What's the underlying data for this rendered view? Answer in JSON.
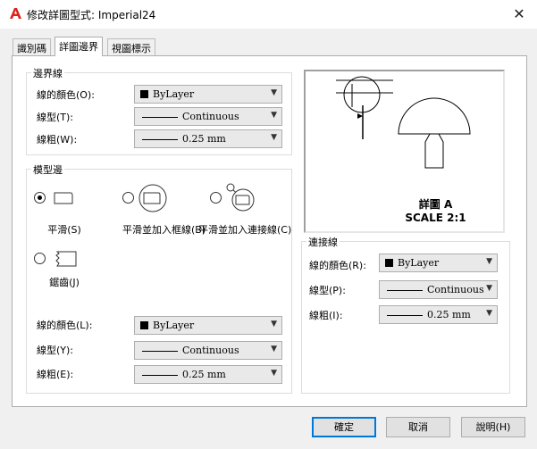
{
  "window": {
    "title": "修改詳圖型式: Imperial24",
    "close_glyph": "✕"
  },
  "tabs": [
    {
      "label": "識別碼",
      "active": false
    },
    {
      "label": "詳圖邊界",
      "active": true
    },
    {
      "label": "視圖標示",
      "active": false
    }
  ],
  "boundary": {
    "title": "邊界線",
    "color": {
      "label": "線的顏色(O):",
      "value": "ByLayer"
    },
    "linetype": {
      "label": "線型(T):",
      "value": "Continuous"
    },
    "lineweight": {
      "label": "線粗(W):",
      "value": "0.25 mm"
    }
  },
  "model_edge": {
    "title": "模型邊",
    "options": [
      {
        "label": "平滑(S)",
        "selected": true
      },
      {
        "label": "平滑並加入框線(B)",
        "selected": false
      },
      {
        "label": "平滑並加入連接線(C)",
        "selected": false
      },
      {
        "label": "鋸齒(J)",
        "selected": false
      }
    ],
    "color": {
      "label": "線的顏色(L):",
      "value": "ByLayer"
    },
    "linetype": {
      "label": "線型(Y):",
      "value": "Continuous"
    },
    "lineweight": {
      "label": "線粗(E):",
      "value": "0.25 mm"
    }
  },
  "preview": {
    "line1": "詳圖 A",
    "line2": "SCALE 2:1"
  },
  "connection": {
    "title": "連接線",
    "color": {
      "label": "線的顏色(R):",
      "value": "ByLayer"
    },
    "linetype": {
      "label": "線型(P):",
      "value": "Continuous"
    },
    "lineweight": {
      "label": "線粗(I):",
      "value": "0.25 mm"
    }
  },
  "buttons": {
    "ok": "確定",
    "cancel": "取消",
    "help": "說明(H)"
  },
  "colors": {
    "app_icon_red": "#d9251d",
    "default_button_border": "#0078d7"
  }
}
